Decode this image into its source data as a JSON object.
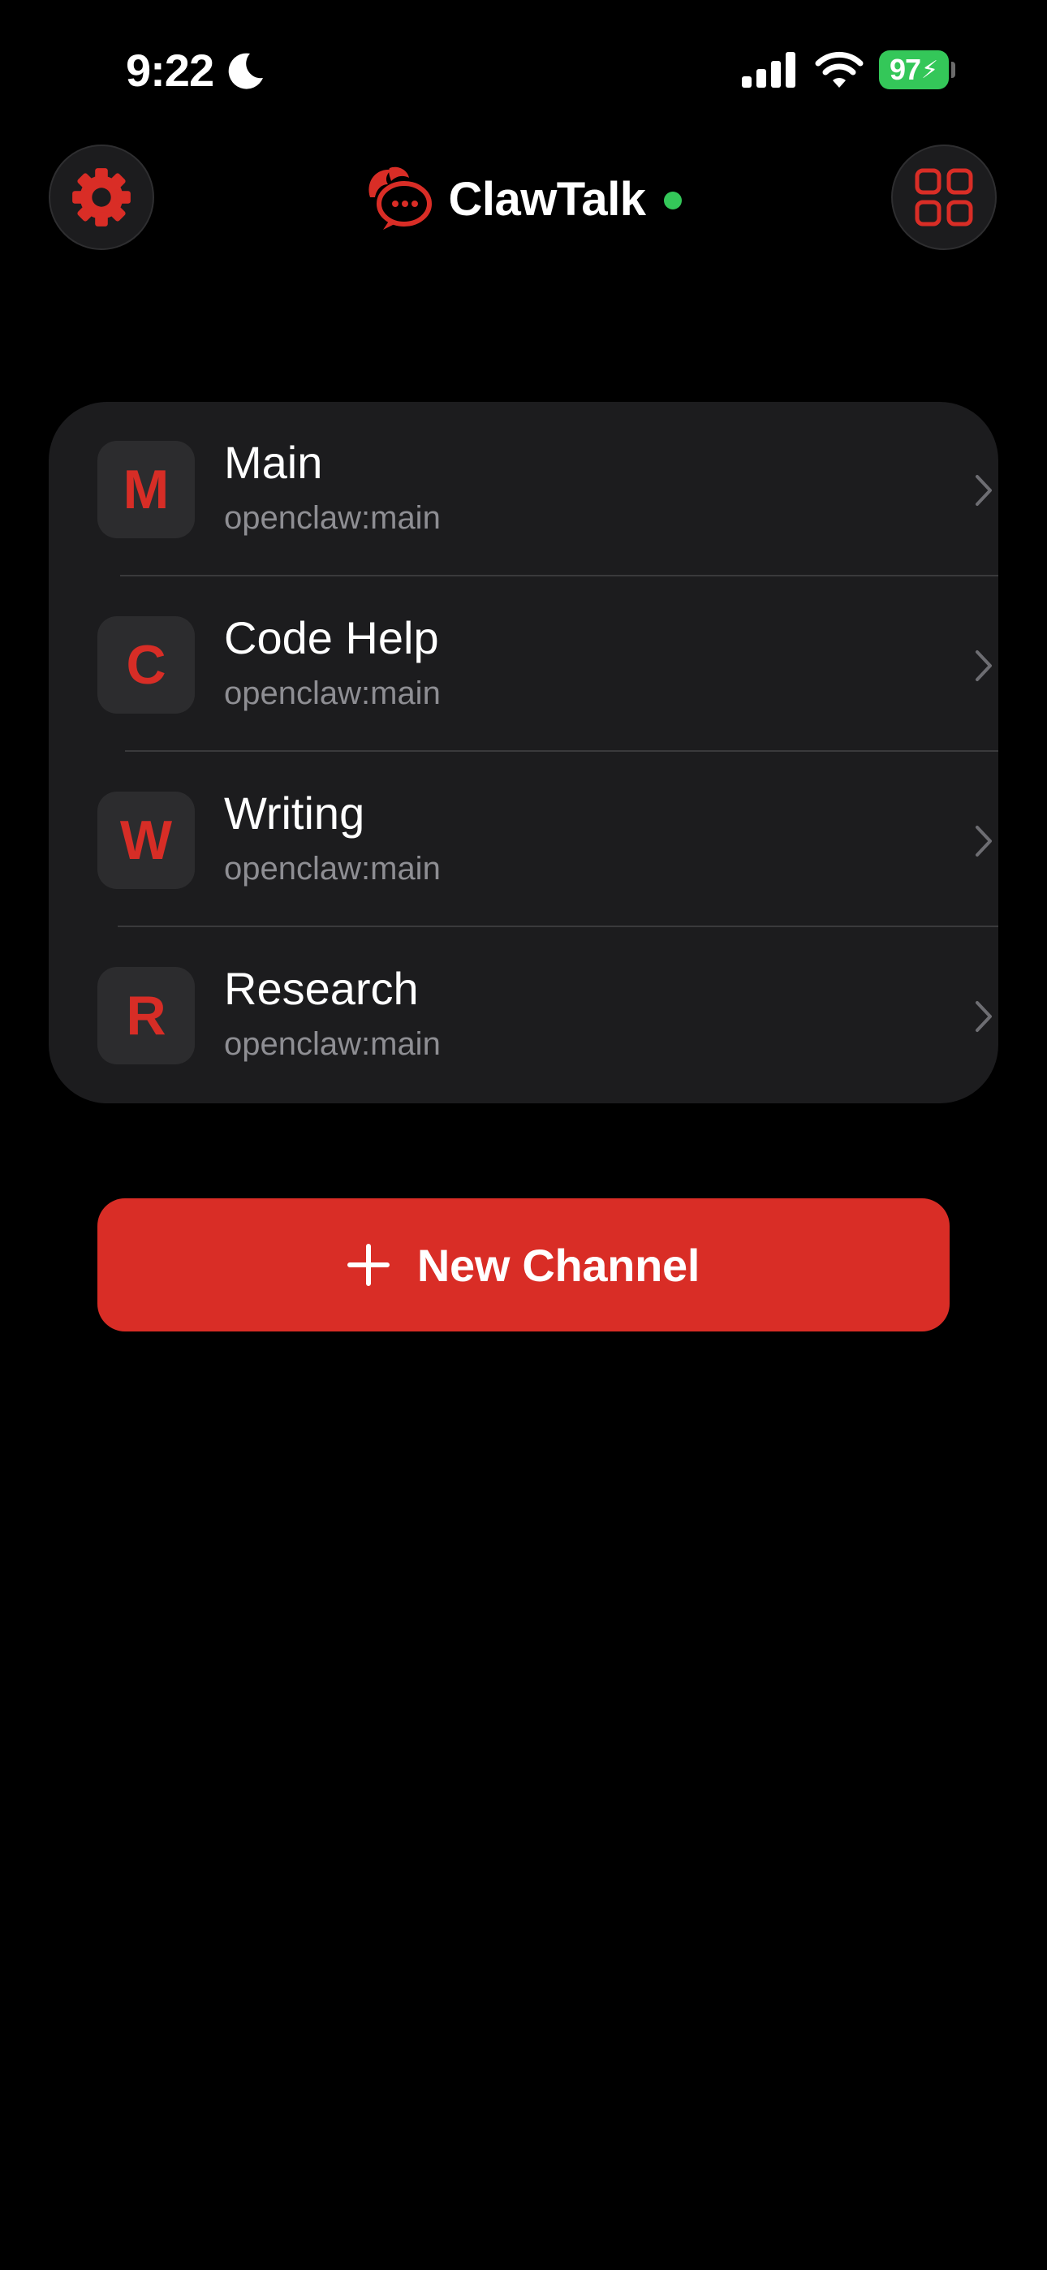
{
  "status_bar": {
    "time": "9:22",
    "battery": "97",
    "icons": [
      "moon-icon",
      "cellular-signal-icon",
      "wifi-icon",
      "battery-charging-icon"
    ]
  },
  "header": {
    "title": "ClawTalk",
    "connection_status_color": "#34c759",
    "settings_icon": "gear-icon",
    "grid_icon": "grid-icon",
    "logo_icon": "claw-chat-bubble-logo"
  },
  "channels": [
    {
      "initial": "M",
      "name": "Main",
      "subtitle": "openclaw:main"
    },
    {
      "initial": "C",
      "name": "Code Help",
      "subtitle": "openclaw:main"
    },
    {
      "initial": "W",
      "name": "Writing",
      "subtitle": "openclaw:main"
    },
    {
      "initial": "R",
      "name": "Research",
      "subtitle": "openclaw:main"
    }
  ],
  "new_channel_button": {
    "label": "New Channel",
    "icon": "plus-icon"
  },
  "colors": {
    "accent": "#d92d26",
    "background": "#000000",
    "card": "#1c1c1e",
    "secondary_text": "#8e8e93"
  }
}
